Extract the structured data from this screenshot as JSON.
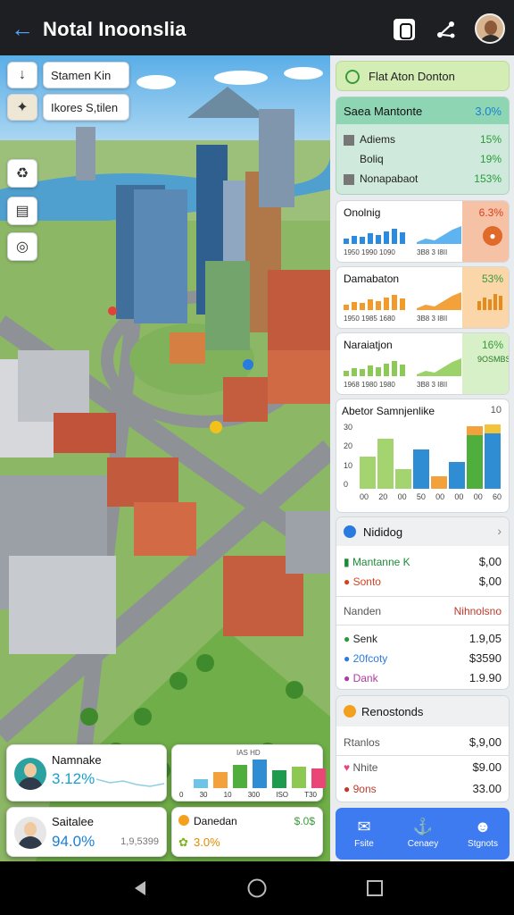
{
  "header": {
    "title": "Notal Inoonslia"
  },
  "map": {
    "chip_top": "Stamen Kin",
    "chip_second": "Ikores S,tilen",
    "cards": {
      "card1": {
        "label": "Namnake",
        "value": "3.12%"
      },
      "card2": {
        "title": "IAS HD",
        "labels": [
          "0",
          "30",
          "10",
          "300",
          "ISO",
          "T30"
        ]
      },
      "card3": {
        "label": "Saitalee",
        "value": "94.0%",
        "sub": "1,9,5399"
      },
      "card4": {
        "label": "Danedan",
        "value": "3.0%",
        "sub": "$.0$"
      }
    }
  },
  "side": {
    "banner": {
      "label": "Flat Aton Donton"
    },
    "table": {
      "title": "Saea Mantonte",
      "title_value": "3.0%",
      "rows": [
        {
          "label": "Adiems",
          "value": "15%"
        },
        {
          "label": "Boliq",
          "value": "19%"
        },
        {
          "label": "Nonapabaot",
          "value": "153%"
        }
      ]
    },
    "mini": [
      {
        "title": "Onolnig",
        "value": "6.3%",
        "axis_left": "1950 1990 1090",
        "axis_right": "3B8 3 I8II",
        "color": "#2a8be0",
        "bg": "#f6c2a6"
      },
      {
        "title": "Damabaton",
        "value": "53%",
        "axis_left": "1950 1985 1680",
        "axis_right": "3B8 3 I8II",
        "color": "#f09b2a",
        "bg": "#fbd6a8"
      },
      {
        "title": "Naraiatjon",
        "value": "16%",
        "axis_left": "1968 1980 1980",
        "axis_right": "3B8 3 I8II",
        "color": "#8cc957",
        "bg": "#d7f0c7",
        "extra": "9OSMBS"
      }
    ],
    "big_chart": {
      "title": "Abetor Samnjenlike",
      "title_value": "10",
      "ytick_labels": [
        "30",
        "20",
        "10",
        "0"
      ],
      "xtick_labels": [
        "00",
        "20",
        "00",
        "50",
        "00",
        "00",
        "00",
        "60"
      ]
    },
    "list1": {
      "title": "Nididog",
      "rows": [
        {
          "label": "Mantanne K",
          "value": "$,00"
        },
        {
          "label": "Sonto",
          "value": "$,00"
        },
        {
          "label": "Nanden",
          "value": "Nihnolsno"
        },
        {
          "label": "Senk",
          "value": "1.9,05"
        },
        {
          "label": "20fcoty",
          "value": "$3590"
        },
        {
          "label": "Dank",
          "value": "1.9.90"
        }
      ]
    },
    "list2": {
      "title": "Renostonds",
      "rows": [
        {
          "label": "Rtanlos",
          "value": "$,9,00"
        },
        {
          "label": "Nhite",
          "value": "$9.00"
        },
        {
          "label": "9ons",
          "value": "33.00"
        }
      ]
    },
    "actions": [
      {
        "label": "Fsite"
      },
      {
        "label": "Cenaey"
      },
      {
        "label": "Stgnots"
      }
    ]
  }
}
